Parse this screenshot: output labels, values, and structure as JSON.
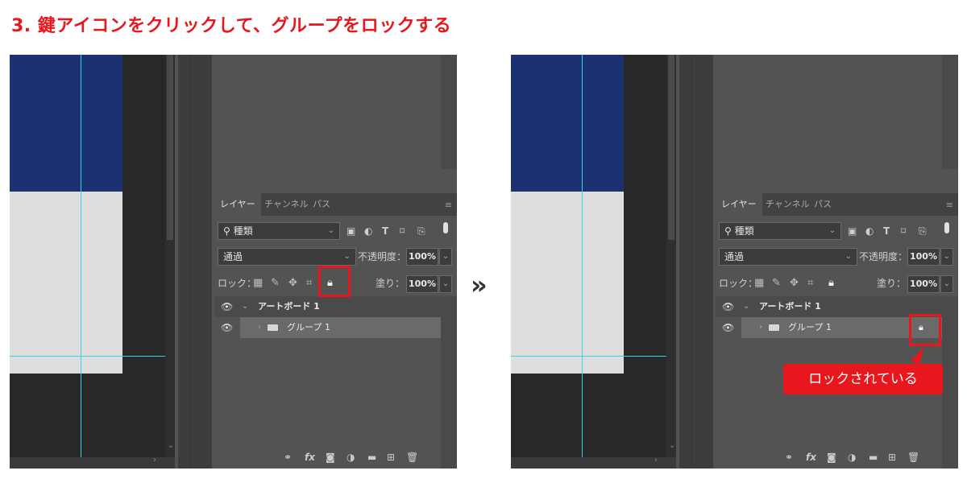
{
  "title": "3. 鍵アイコンをクリックして、グループをロックする",
  "separator": "»",
  "panel": {
    "tabs": {
      "layers": "レイヤー",
      "channels": "チャンネル",
      "paths": "パス"
    },
    "filter_label": "種類",
    "blend_mode": "通過",
    "opacity_label": "不透明度：",
    "opacity_value": "100%",
    "lock_label": "ロック：",
    "fill_label": "塗り：",
    "fill_value": "100%",
    "layers": {
      "artboard": "アートボード 1",
      "group": "グループ 1"
    },
    "fx_label": "fx"
  },
  "callout": "ロックされている",
  "colors": {
    "accent_red": "#e8161d",
    "artboard_blue": "#1c316f",
    "guide_cyan": "#33d6e8",
    "panel_bg": "#535353"
  },
  "icons": [
    "search-icon",
    "image-filter-icon",
    "adjustment-filter-icon",
    "type-filter-icon",
    "shape-filter-icon",
    "smart-object-filter-icon",
    "transparency-lock-icon",
    "brush-lock-icon",
    "move-lock-icon",
    "artboard-lock-icon",
    "lock-icon",
    "eye-icon",
    "folder-icon",
    "link-icon",
    "mask-icon",
    "adjustment-icon",
    "new-group-icon",
    "new-layer-icon",
    "trash-icon"
  ]
}
